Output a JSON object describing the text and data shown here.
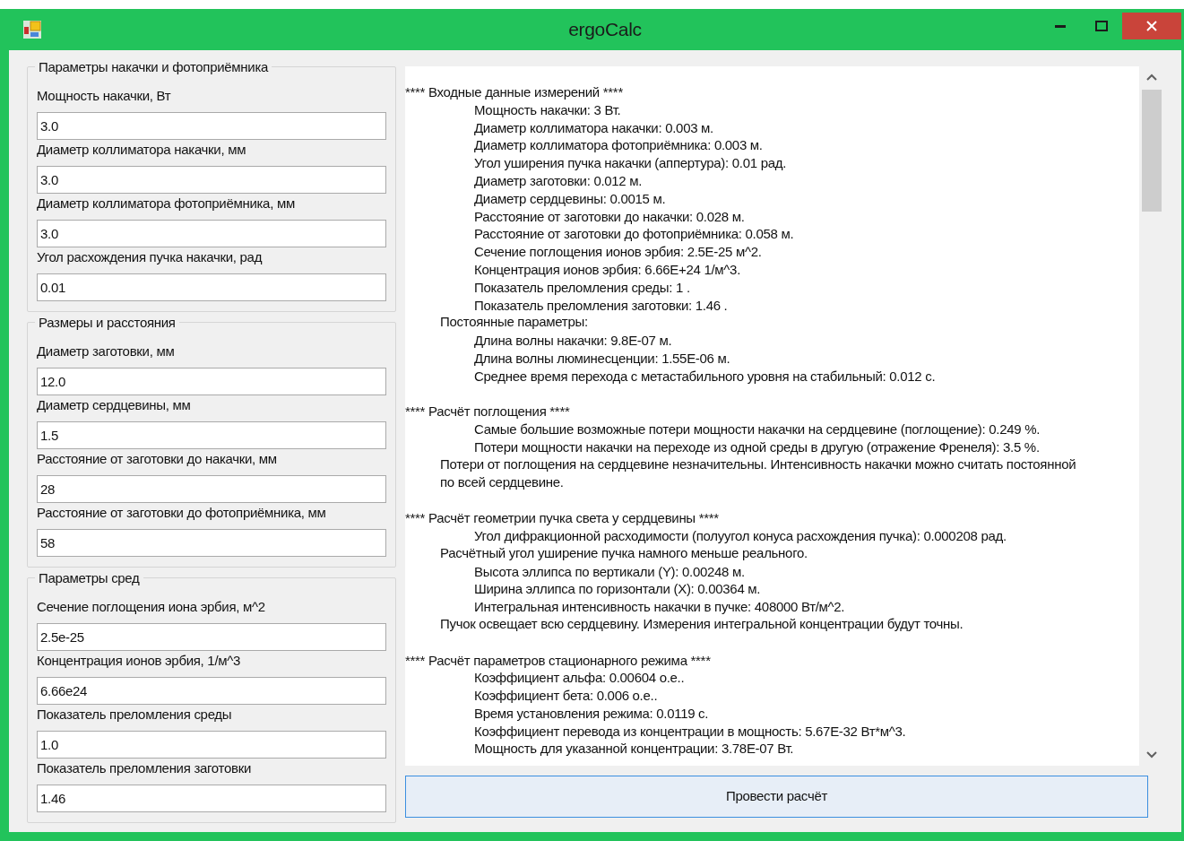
{
  "window": {
    "title": "ergoCalc"
  },
  "groups": [
    {
      "title": "Параметры накачки и фотоприёмника",
      "fields": [
        {
          "label": "Мощность накачки, Вт",
          "value": "3.0"
        },
        {
          "label": "Диаметр коллиматора накачки, мм",
          "value": "3.0"
        },
        {
          "label": "Диаметр коллиматора фотоприёмника, мм",
          "value": "3.0"
        },
        {
          "label": "Угол расхождения пучка накачки, рад",
          "value": "0.01"
        }
      ]
    },
    {
      "title": "Размеры и расстояния",
      "fields": [
        {
          "label": "Диаметр заготовки, мм",
          "value": "12.0"
        },
        {
          "label": "Диаметр сердцевины, мм",
          "value": "1.5"
        },
        {
          "label": "Расстояние от заготовки до накачки, мм",
          "value": "28"
        },
        {
          "label": "Расстояние от заготовки до фотоприёмника, мм",
          "value": "58"
        }
      ]
    },
    {
      "title": "Параметры сред",
      "fields": [
        {
          "label": "Сечение поглощения иона эрбия, м^2",
          "value": "2.5e-25"
        },
        {
          "label": "Концентрация ионов эрбия, 1/м^3",
          "value": "6.66e24"
        },
        {
          "label": "Показатель преломления среды",
          "value": "1.0"
        },
        {
          "label": "Показатель преломления заготовки",
          "value": "1.46"
        }
      ]
    }
  ],
  "output": {
    "lines": [
      {
        "kind": "header",
        "text": "**** Входные данные измерений ****"
      },
      {
        "kind": "item",
        "text": "Мощность накачки: 3 Вт."
      },
      {
        "kind": "item",
        "text": "Диаметр коллиматора накачки: 0.003 м."
      },
      {
        "kind": "item",
        "text": "Диаметр коллиматора фотоприёмника: 0.003 м."
      },
      {
        "kind": "item",
        "text": "Угол уширения пучка накачки (аппертура): 0.01 рад."
      },
      {
        "kind": "item",
        "text": "Диаметр заготовки: 0.012 м."
      },
      {
        "kind": "item",
        "text": "Диаметр сердцевины: 0.0015 м."
      },
      {
        "kind": "item",
        "text": "Расстояние от заготовки до накачки: 0.028 м."
      },
      {
        "kind": "item",
        "text": "Расстояние от заготовки до фотоприёмника: 0.058 м."
      },
      {
        "kind": "item",
        "text": "Сечение поглощения ионов эрбия: 2.5E-25 м^2."
      },
      {
        "kind": "item",
        "text": "Концентрация ионов эрбия: 6.66E+24 1/м^3."
      },
      {
        "kind": "item",
        "text": "Показатель преломления среды: 1 ."
      },
      {
        "kind": "item",
        "text": "Показатель преломления заготовки: 1.46 ."
      },
      {
        "kind": "note",
        "text": "Постоянные параметры:"
      },
      {
        "kind": "item",
        "text": "Длина волны накачки: 9.8E-07 м."
      },
      {
        "kind": "item",
        "text": "Длина волны люминесценции: 1.55E-06 м."
      },
      {
        "kind": "item",
        "text": "Среднее время перехода с метастабильного уровня на стабильный: 0.012 с."
      },
      {
        "kind": "blank"
      },
      {
        "kind": "header",
        "text": "**** Расчёт поглощения ****"
      },
      {
        "kind": "item",
        "text": "Самые большие возможные потери мощности накачки на сердцевине (поглощение): 0.249 %."
      },
      {
        "kind": "item",
        "text": "Потери мощности накачки на переходе из одной среды в другую (отражение Френеля): 3.5 %."
      },
      {
        "kind": "note",
        "text": "Потери от поглощения на сердцевине незначительны. Интенсивность накачки можно считать постоянной по всей сердцевине."
      },
      {
        "kind": "blank"
      },
      {
        "kind": "header",
        "text": "**** Расчёт геометрии пучка света у сердцевины ****"
      },
      {
        "kind": "item",
        "text": "Угол дифракционной расходимости (полуугол конуса расхождения пучка): 0.000208 рад."
      },
      {
        "kind": "note",
        "text": "Расчётный угол уширение пучка намного меньше реального."
      },
      {
        "kind": "item",
        "text": "Высота эллипса по вертикали (Y): 0.00248 м."
      },
      {
        "kind": "item",
        "text": "Ширина эллипса по горизонтали (X): 0.00364 м."
      },
      {
        "kind": "item",
        "text": "Интегральная интенсивность накачки в пучке: 408000 Вт/м^2."
      },
      {
        "kind": "note",
        "text": "Пучок освещает всю сердцевину. Измерения интегральной концентрации будут точны."
      },
      {
        "kind": "blank"
      },
      {
        "kind": "header",
        "text": "**** Расчёт параметров стационарного режима ****"
      },
      {
        "kind": "item",
        "text": "Коэффициент альфа: 0.00604 о.е.."
      },
      {
        "kind": "item",
        "text": "Коэффициент бета: 0.006 о.е.."
      },
      {
        "kind": "item",
        "text": "Время установления режима: 0.0119 с."
      },
      {
        "kind": "item",
        "text": "Коэффициент перевода из концентрации в мощность: 5.67E-32 Вт*м^3."
      },
      {
        "kind": "item",
        "text": "Мощность для указанной концентрации: 3.78E-07 Вт."
      }
    ]
  },
  "button": {
    "label": "Провести расчёт"
  }
}
